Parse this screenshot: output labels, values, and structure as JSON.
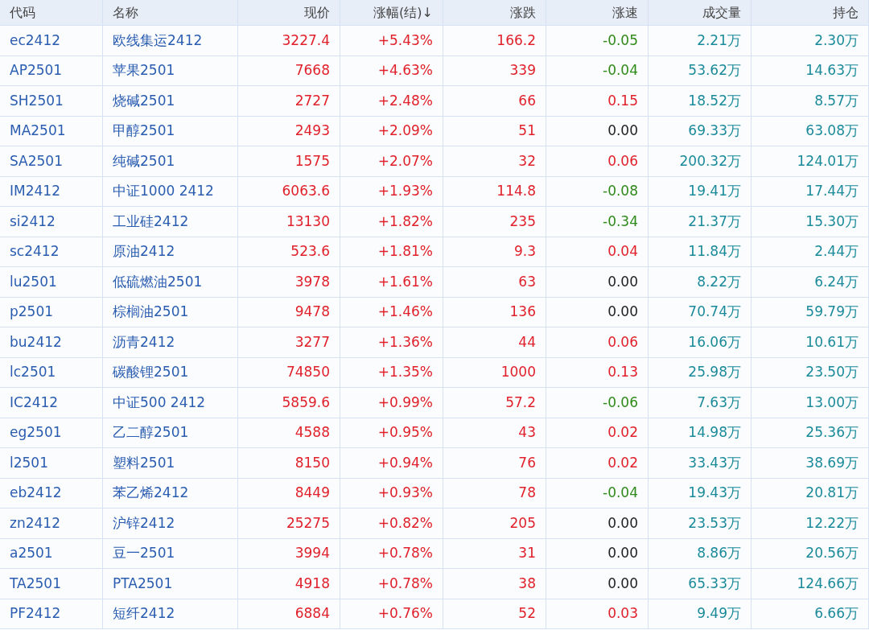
{
  "table": {
    "columns": [
      "代码",
      "名称",
      "现价",
      "涨幅(结)↓",
      "涨跌",
      "涨速",
      "成交量",
      "持仓"
    ],
    "rows": [
      {
        "code": "ec2412",
        "name": "欧线集运2412",
        "price": "3227.4",
        "pct": "+5.43%",
        "change": "166.2",
        "speed": {
          "value": "-0.05",
          "color": "#2f8a1a"
        },
        "volume": "2.21万",
        "open_interest": "2.30万",
        "color": "#e0202a"
      },
      {
        "code": "AP2501",
        "name": "苹果2501",
        "price": "7668",
        "pct": "+4.63%",
        "change": "339",
        "speed": {
          "value": "-0.04",
          "color": "#2f8a1a"
        },
        "volume": "53.62万",
        "open_interest": "14.63万",
        "color": "#e0202a"
      },
      {
        "code": "SH2501",
        "name": "烧碱2501",
        "price": "2727",
        "pct": "+2.48%",
        "change": "66",
        "speed": {
          "value": "0.15",
          "color": "#e0202a"
        },
        "volume": "18.52万",
        "open_interest": "8.57万",
        "color": "#e0202a"
      },
      {
        "code": "MA2501",
        "name": "甲醇2501",
        "price": "2493",
        "pct": "+2.09%",
        "change": "51",
        "speed": {
          "value": "0.00",
          "color": "#222222"
        },
        "volume": "69.33万",
        "open_interest": "63.08万",
        "color": "#e0202a"
      },
      {
        "code": "SA2501",
        "name": "纯碱2501",
        "price": "1575",
        "pct": "+2.07%",
        "change": "32",
        "speed": {
          "value": "0.06",
          "color": "#e0202a"
        },
        "volume": "200.32万",
        "open_interest": "124.01万",
        "color": "#e0202a"
      },
      {
        "code": "IM2412",
        "name": "中证1000 2412",
        "price": "6063.6",
        "pct": "+1.93%",
        "change": "114.8",
        "speed": {
          "value": "-0.08",
          "color": "#2f8a1a"
        },
        "volume": "19.41万",
        "open_interest": "17.44万",
        "color": "#e0202a"
      },
      {
        "code": "si2412",
        "name": "工业硅2412",
        "price": "13130",
        "pct": "+1.82%",
        "change": "235",
        "speed": {
          "value": "-0.34",
          "color": "#2f8a1a"
        },
        "volume": "21.37万",
        "open_interest": "15.30万",
        "color": "#e0202a"
      },
      {
        "code": "sc2412",
        "name": "原油2412",
        "price": "523.6",
        "pct": "+1.81%",
        "change": "9.3",
        "speed": {
          "value": "0.04",
          "color": "#e0202a"
        },
        "volume": "11.84万",
        "open_interest": "2.44万",
        "color": "#e0202a"
      },
      {
        "code": "lu2501",
        "name": "低硫燃油2501",
        "price": "3978",
        "pct": "+1.61%",
        "change": "63",
        "speed": {
          "value": "0.00",
          "color": "#222222"
        },
        "volume": "8.22万",
        "open_interest": "6.24万",
        "color": "#e0202a"
      },
      {
        "code": "p2501",
        "name": "棕榈油2501",
        "price": "9478",
        "pct": "+1.46%",
        "change": "136",
        "speed": {
          "value": "0.00",
          "color": "#222222"
        },
        "volume": "70.74万",
        "open_interest": "59.79万",
        "color": "#e0202a"
      },
      {
        "code": "bu2412",
        "name": "沥青2412",
        "price": "3277",
        "pct": "+1.36%",
        "change": "44",
        "speed": {
          "value": "0.06",
          "color": "#e0202a"
        },
        "volume": "16.06万",
        "open_interest": "10.61万",
        "color": "#e0202a"
      },
      {
        "code": "lc2501",
        "name": "碳酸锂2501",
        "price": "74850",
        "pct": "+1.35%",
        "change": "1000",
        "speed": {
          "value": "0.13",
          "color": "#e0202a"
        },
        "volume": "25.98万",
        "open_interest": "23.50万",
        "color": "#e0202a"
      },
      {
        "code": "IC2412",
        "name": "中证500 2412",
        "price": "5859.6",
        "pct": "+0.99%",
        "change": "57.2",
        "speed": {
          "value": "-0.06",
          "color": "#2f8a1a"
        },
        "volume": "7.63万",
        "open_interest": "13.00万",
        "color": "#e0202a"
      },
      {
        "code": "eg2501",
        "name": "乙二醇2501",
        "price": "4588",
        "pct": "+0.95%",
        "change": "43",
        "speed": {
          "value": "0.02",
          "color": "#e0202a"
        },
        "volume": "14.98万",
        "open_interest": "25.36万",
        "color": "#e0202a"
      },
      {
        "code": "l2501",
        "name": "塑料2501",
        "price": "8150",
        "pct": "+0.94%",
        "change": "76",
        "speed": {
          "value": "0.02",
          "color": "#e0202a"
        },
        "volume": "33.43万",
        "open_interest": "38.69万",
        "color": "#e0202a"
      },
      {
        "code": "eb2412",
        "name": "苯乙烯2412",
        "price": "8449",
        "pct": "+0.93%",
        "change": "78",
        "speed": {
          "value": "-0.04",
          "color": "#2f8a1a"
        },
        "volume": "19.43万",
        "open_interest": "20.81万",
        "color": "#e0202a"
      },
      {
        "code": "zn2412",
        "name": "沪锌2412",
        "price": "25275",
        "pct": "+0.82%",
        "change": "205",
        "speed": {
          "value": "0.00",
          "color": "#222222"
        },
        "volume": "23.53万",
        "open_interest": "12.22万",
        "color": "#e0202a"
      },
      {
        "code": "a2501",
        "name": "豆一2501",
        "price": "3994",
        "pct": "+0.78%",
        "change": "31",
        "speed": {
          "value": "0.00",
          "color": "#222222"
        },
        "volume": "8.86万",
        "open_interest": "20.56万",
        "color": "#e0202a"
      },
      {
        "code": "TA2501",
        "name": "PTA2501",
        "price": "4918",
        "pct": "+0.78%",
        "change": "38",
        "speed": {
          "value": "0.00",
          "color": "#222222"
        },
        "volume": "65.33万",
        "open_interest": "124.66万",
        "color": "#e0202a"
      },
      {
        "code": "PF2412",
        "name": "短纤2412",
        "price": "6884",
        "pct": "+0.76%",
        "change": "52",
        "speed": {
          "value": "0.03",
          "color": "#e0202a"
        },
        "volume": "9.49万",
        "open_interest": "6.66万",
        "color": "#e0202a"
      }
    ]
  }
}
